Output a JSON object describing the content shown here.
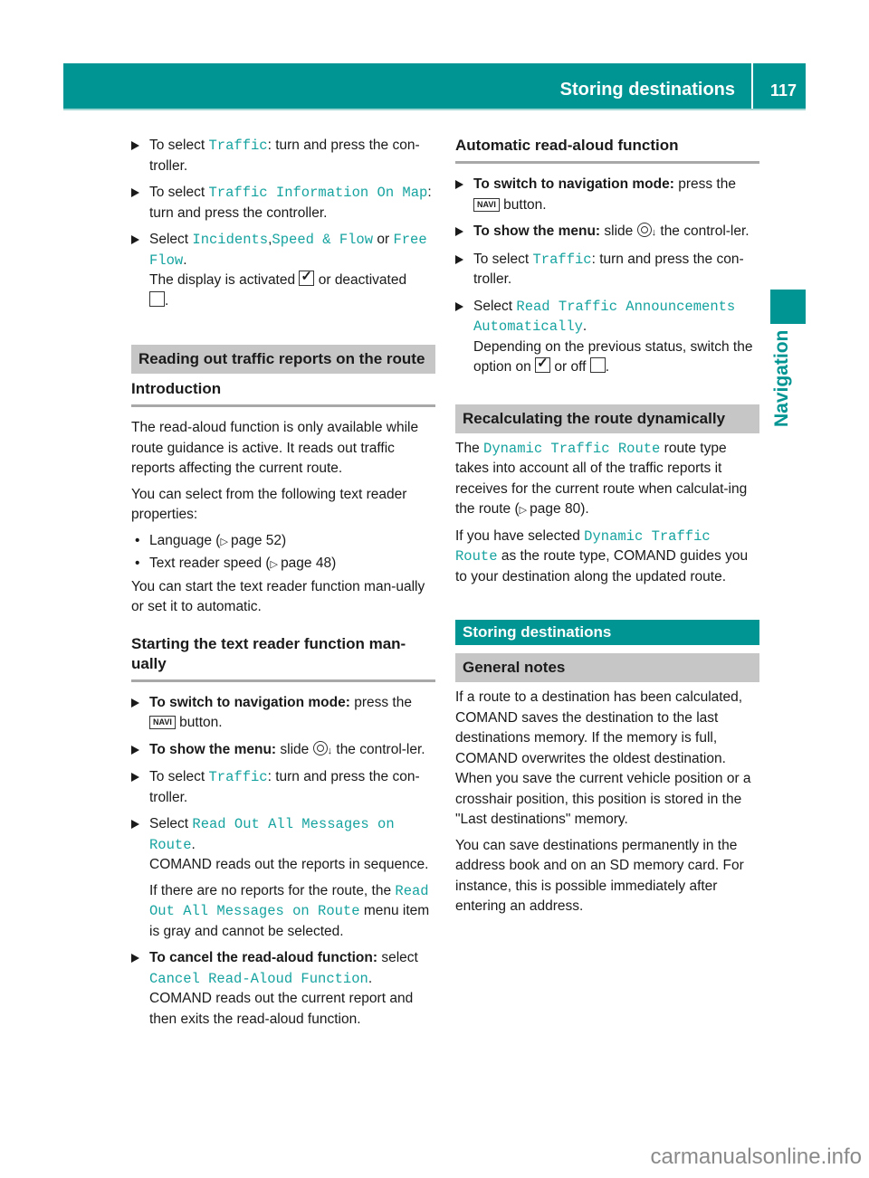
{
  "header": {
    "title": "Storing destinations",
    "page_number": "117",
    "accent_color": "#009593"
  },
  "side_tab": {
    "label": "Navigation"
  },
  "left_column": {
    "steps_top": [
      {
        "prefix": "To select ",
        "code": "Traffic",
        "suffix": ": turn and press the con-troller."
      },
      {
        "prefix": "To select ",
        "code": "Traffic Information On Map",
        "suffix": ": turn and press the controller."
      },
      {
        "prefix": "Select ",
        "code": "Incidents",
        "mid1": ",",
        "code2": "Speed & Flow",
        "mid2": " or ",
        "code3": "Free Flow",
        "suffix": ".",
        "note_a": "The display is activated",
        "note_b": " or deactivated",
        "note_c": "."
      }
    ],
    "section_heading": "Reading out traffic reports on the route",
    "intro_heading": "Introduction",
    "intro_p1": "The read-aloud function is only available while route guidance is active. It reads out traffic reports affecting the current route.",
    "intro_p2": "You can select from the following text reader properties:",
    "bullets": [
      {
        "text": "Language (",
        "page": "page 52",
        "close": ")"
      },
      {
        "text": "Text reader speed (",
        "page": "page 48",
        "close": ")"
      }
    ],
    "intro_p3": "You can start the text reader function man-ually or set it to automatic.",
    "manual_heading": "Starting the text reader function man-ually",
    "manual_steps": {
      "s1_bold": "To switch to navigation mode:",
      "s1_text": " press the ",
      "s1_key": "NAVI",
      "s1_end": " button.",
      "s2_bold": "To show the menu:",
      "s2_a": " slide ",
      "s2_b": " the control-ler.",
      "s3_prefix": "To select ",
      "s3_code": "Traffic",
      "s3_suffix": ": turn and press the con-troller.",
      "s4_prefix": "Select ",
      "s4_code": "Read Out All Messages on Route",
      "s4_suffix": ".",
      "s4_note1": "COMAND reads out the reports in sequence.",
      "s4_note2a": "If there are no reports for the route, the ",
      "s4_note2_code": "Read Out All Messages on Route",
      "s4_note2b": " menu item is gray and cannot be selected.",
      "s5_bold": "To cancel the read-aloud function:",
      "s5_text": " select ",
      "s5_code": "Cancel Read-Aloud Function",
      "s5_suffix": ".",
      "s5_note": "COMAND reads out the current report and then exits the read-aloud function."
    }
  },
  "right_column": {
    "auto_heading": "Automatic read-aloud function",
    "auto_steps": {
      "s1_bold": "To switch to navigation mode:",
      "s1_text": " press the ",
      "s1_key": "NAVI",
      "s1_end": " button.",
      "s2_bold": "To show the menu:",
      "s2_a": " slide ",
      "s2_b": " the control-ler.",
      "s3_prefix": "To select ",
      "s3_code": "Traffic",
      "s3_suffix": ": turn and press the con-troller.",
      "s4_prefix": "Select ",
      "s4_code": "Read Traffic Announcements Automatically",
      "s4_suffix": ".",
      "s4_note_a": "Depending on the previous status, switch the option on ",
      "s4_note_b": " or off ",
      "s4_note_c": "."
    },
    "recalc_heading": "Recalculating the route dynamically",
    "recalc_p1_a": "The ",
    "recalc_p1_code": "Dynamic Traffic Route",
    "recalc_p1_b": " route type takes into account all of the traffic reports it receives for the current route when calculat-ing the route (",
    "recalc_p1_page": "page 80",
    "recalc_p1_c": ").",
    "recalc_p2_a": "If you have selected ",
    "recalc_p2_code": "Dynamic Traffic Route",
    "recalc_p2_b": " as the route type, COMAND guides you to your destination along the updated route.",
    "storing_heading": "Storing destinations",
    "general_heading": "General notes",
    "general_p1": "If a route to a destination has been calculated, COMAND saves the destination to the last destinations memory. If the memory is full, COMAND overwrites the oldest destination. When you save the current vehicle position or a crosshair position, this position is stored in the \"Last destinations\" memory.",
    "general_p2": "You can save destinations permanently in the address book and on an SD memory card. For instance, this is possible immediately after entering an address."
  },
  "watermark": "carmanualsonline.info"
}
